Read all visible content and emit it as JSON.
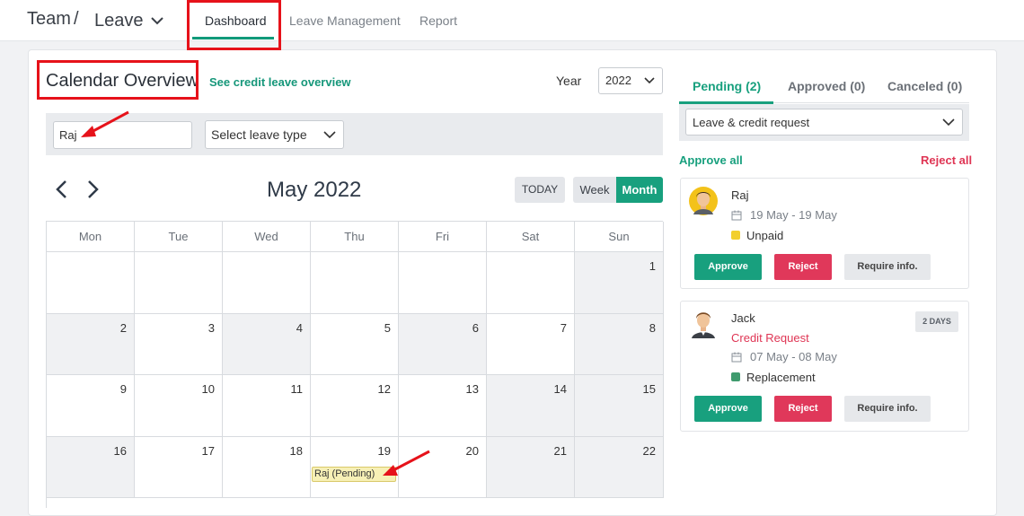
{
  "breadcrumb": {
    "team": "Team",
    "separator": "/",
    "leave": "Leave"
  },
  "nav_tabs": [
    {
      "label": "Dashboard",
      "active": true
    },
    {
      "label": "Leave Management",
      "active": false
    },
    {
      "label": "Report",
      "active": false
    }
  ],
  "calendar_header": {
    "title": "Calendar Overview",
    "credit_link": "See credit leave overview",
    "year_label": "Year",
    "year_value": "2022"
  },
  "filters": {
    "name_value": "Raj",
    "leave_type_value": "Select leave type"
  },
  "calendar": {
    "month_title": "May 2022",
    "today_label": "TODAY",
    "week_label": "Week",
    "month_label": "Month",
    "weekdays": [
      "Mon",
      "Tue",
      "Wed",
      "Thu",
      "Fri",
      "Sat",
      "Sun"
    ],
    "weeks": [
      [
        "",
        "",
        "",
        "",
        "",
        "",
        "1"
      ],
      [
        "2",
        "3",
        "4",
        "5",
        "6",
        "7",
        "8"
      ],
      [
        "9",
        "10",
        "11",
        "12",
        "13",
        "14",
        "15"
      ],
      [
        "16",
        "17",
        "18",
        "19",
        "20",
        "21",
        "22"
      ]
    ],
    "event_label": "Raj (Pending)"
  },
  "right_panel": {
    "tabs": [
      {
        "label": "Pending (2)",
        "active": true
      },
      {
        "label": "Approved (0)",
        "active": false
      },
      {
        "label": "Canceled (0)",
        "active": false
      }
    ],
    "request_filter": "Leave & credit request",
    "approve_all": "Approve all",
    "reject_all": "Reject all",
    "requests": [
      {
        "name": "Raj",
        "dates": "19 May - 19 May",
        "type": "Unpaid",
        "type_color": "#f2cf2e",
        "approve": "Approve",
        "reject": "Reject",
        "require_info": "Require info."
      },
      {
        "name": "Jack",
        "badge": "2 DAYS",
        "credit_label": "Credit Request",
        "dates": "07 May - 08 May",
        "type": "Replacement",
        "type_color": "#3f9b6e",
        "approve": "Approve",
        "reject": "Reject",
        "require_info": "Require info."
      }
    ]
  },
  "colors": {
    "accent": "#18a07e",
    "danger": "#e0385a",
    "annotation": "#e6121a"
  }
}
